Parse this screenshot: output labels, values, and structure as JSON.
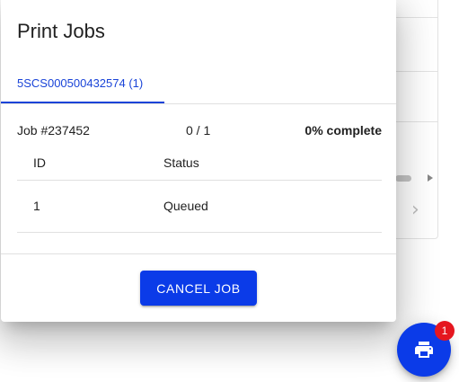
{
  "dialog": {
    "title": "Print Jobs",
    "tabs": [
      {
        "label": "5SCS000500432574 (1)",
        "active": true
      }
    ]
  },
  "job": {
    "id_label": "Job #237452",
    "progress_count": "0 / 1",
    "percent_label": "0% complete",
    "percent_value": 0
  },
  "table": {
    "columns": [
      "ID",
      "Status"
    ],
    "rows": [
      {
        "id": "1",
        "status": "Queued"
      }
    ]
  },
  "actions": {
    "cancel_label": "CANCEL JOB"
  },
  "fab": {
    "icon": "printer-icon",
    "badge_count": "1"
  },
  "background": {
    "chevron_icon": "chevron-right-icon"
  },
  "colors": {
    "primary": "#0b3be8",
    "tab_text": "#1a44d8",
    "badge": "#e5161f",
    "divider": "#e0e0e0"
  }
}
